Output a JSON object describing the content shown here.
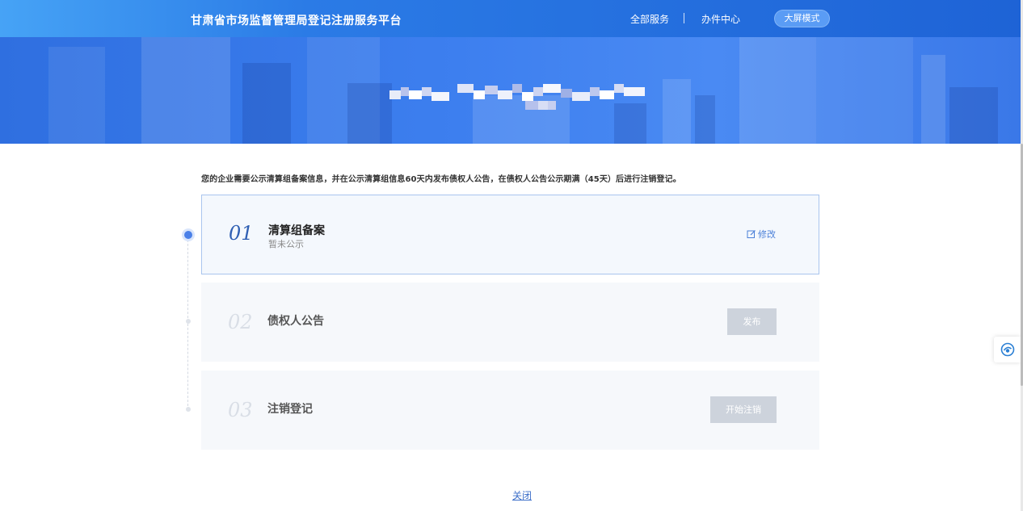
{
  "header": {
    "site_title": "甘肃省市场监督管理局登记注册服务平台",
    "nav": [
      {
        "label": "全部服务"
      },
      {
        "label": "办件中心"
      }
    ],
    "screen_mode_label": "大屏模式"
  },
  "notice_text": "您的企业需要公示清算组备案信息，并在公示清算组信息60天内发布债权人公告，在债权人公告公示期满（45天）后进行注销登记。",
  "steps": [
    {
      "num": "01",
      "title": "清算组备案",
      "subtitle": "暂未公示",
      "action_label": "修改",
      "action_icon": "edit-icon",
      "state": "active"
    },
    {
      "num": "02",
      "title": "债权人公告",
      "action_label": "发布",
      "state": "disabled"
    },
    {
      "num": "03",
      "title": "注销登记",
      "action_label": "开始注销",
      "state": "disabled"
    }
  ],
  "close_label": "关闭",
  "colors": {
    "accent": "#4a80e8",
    "header_blue": "#2b7be6",
    "disabled_button": "#cdd3dc",
    "step_bg": "#f6f8fb",
    "link": "#3d6fc9"
  },
  "float_button_icon": "service-icon"
}
